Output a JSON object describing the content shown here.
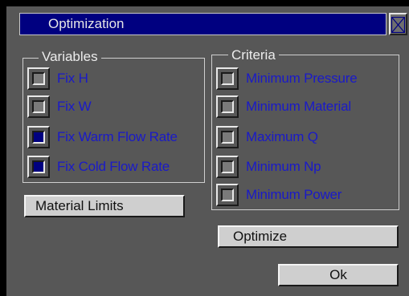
{
  "dialog": {
    "title": "Optimization",
    "close_icon": "close-x-icon"
  },
  "variables": {
    "label": "Variables",
    "items": [
      {
        "label": "Fix H",
        "checked": false
      },
      {
        "label": "Fix W",
        "checked": false
      },
      {
        "label": "Fix Warm Flow Rate",
        "checked": true
      },
      {
        "label": "Fix Cold Flow Rate",
        "checked": true
      }
    ]
  },
  "criteria": {
    "label": "Criteria",
    "items": [
      {
        "label": "Minimum Pressure",
        "checked": false
      },
      {
        "label": "Minimum Material",
        "checked": false
      },
      {
        "label": "Maximum Q",
        "checked": false
      },
      {
        "label": "Minimum Np",
        "checked": false
      },
      {
        "label": "Minimum Power",
        "checked": false
      }
    ]
  },
  "buttons": {
    "material_limits": "Material Limits",
    "optimize": "Optimize",
    "ok": "Ok"
  },
  "colors": {
    "title_bar": "#000080",
    "panel": "#575757",
    "label_text": "#1a1ac8",
    "checked_fill": "#000080"
  }
}
